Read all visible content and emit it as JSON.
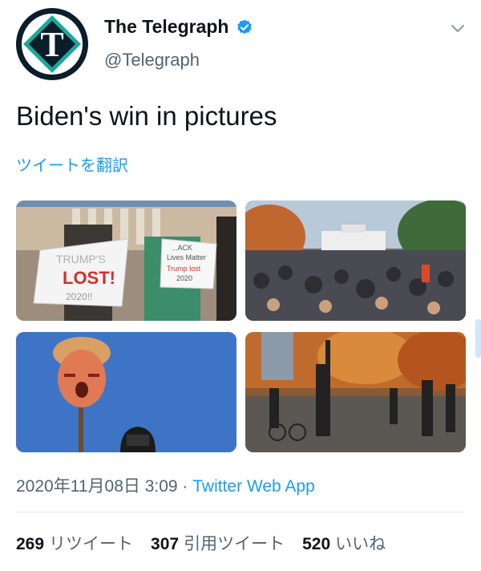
{
  "account": {
    "name": "The Telegraph",
    "handle": "@Telegraph",
    "logo_letter": "T",
    "verified": true,
    "brand_color": "#1aa99b"
  },
  "tweet": {
    "text": "Biden's win in pictures",
    "translate_label": "ツイートを翻訳"
  },
  "photos": [
    {
      "signs": [
        "TRUMP'S",
        "LOST!",
        "2020!!",
        "...ACK",
        "Lives Matter",
        "Trump lost",
        "2020"
      ]
    },
    {},
    {},
    {}
  ],
  "meta": {
    "timestamp": "2020年11月08日 3:09",
    "separator": " · ",
    "source": "Twitter Web App"
  },
  "stats": {
    "retweets_count": "269",
    "retweets_label": "リツイート",
    "quotes_count": "307",
    "quotes_label": "引用ツイート",
    "likes_count": "520",
    "likes_label": "いいね"
  },
  "colors": {
    "link": "#1d9bf0",
    "secondary_text": "#536471",
    "verified": "#1d9bf0"
  },
  "icons": [
    "telegraph-logo-icon",
    "verified-badge-icon",
    "chevron-down-icon"
  ]
}
